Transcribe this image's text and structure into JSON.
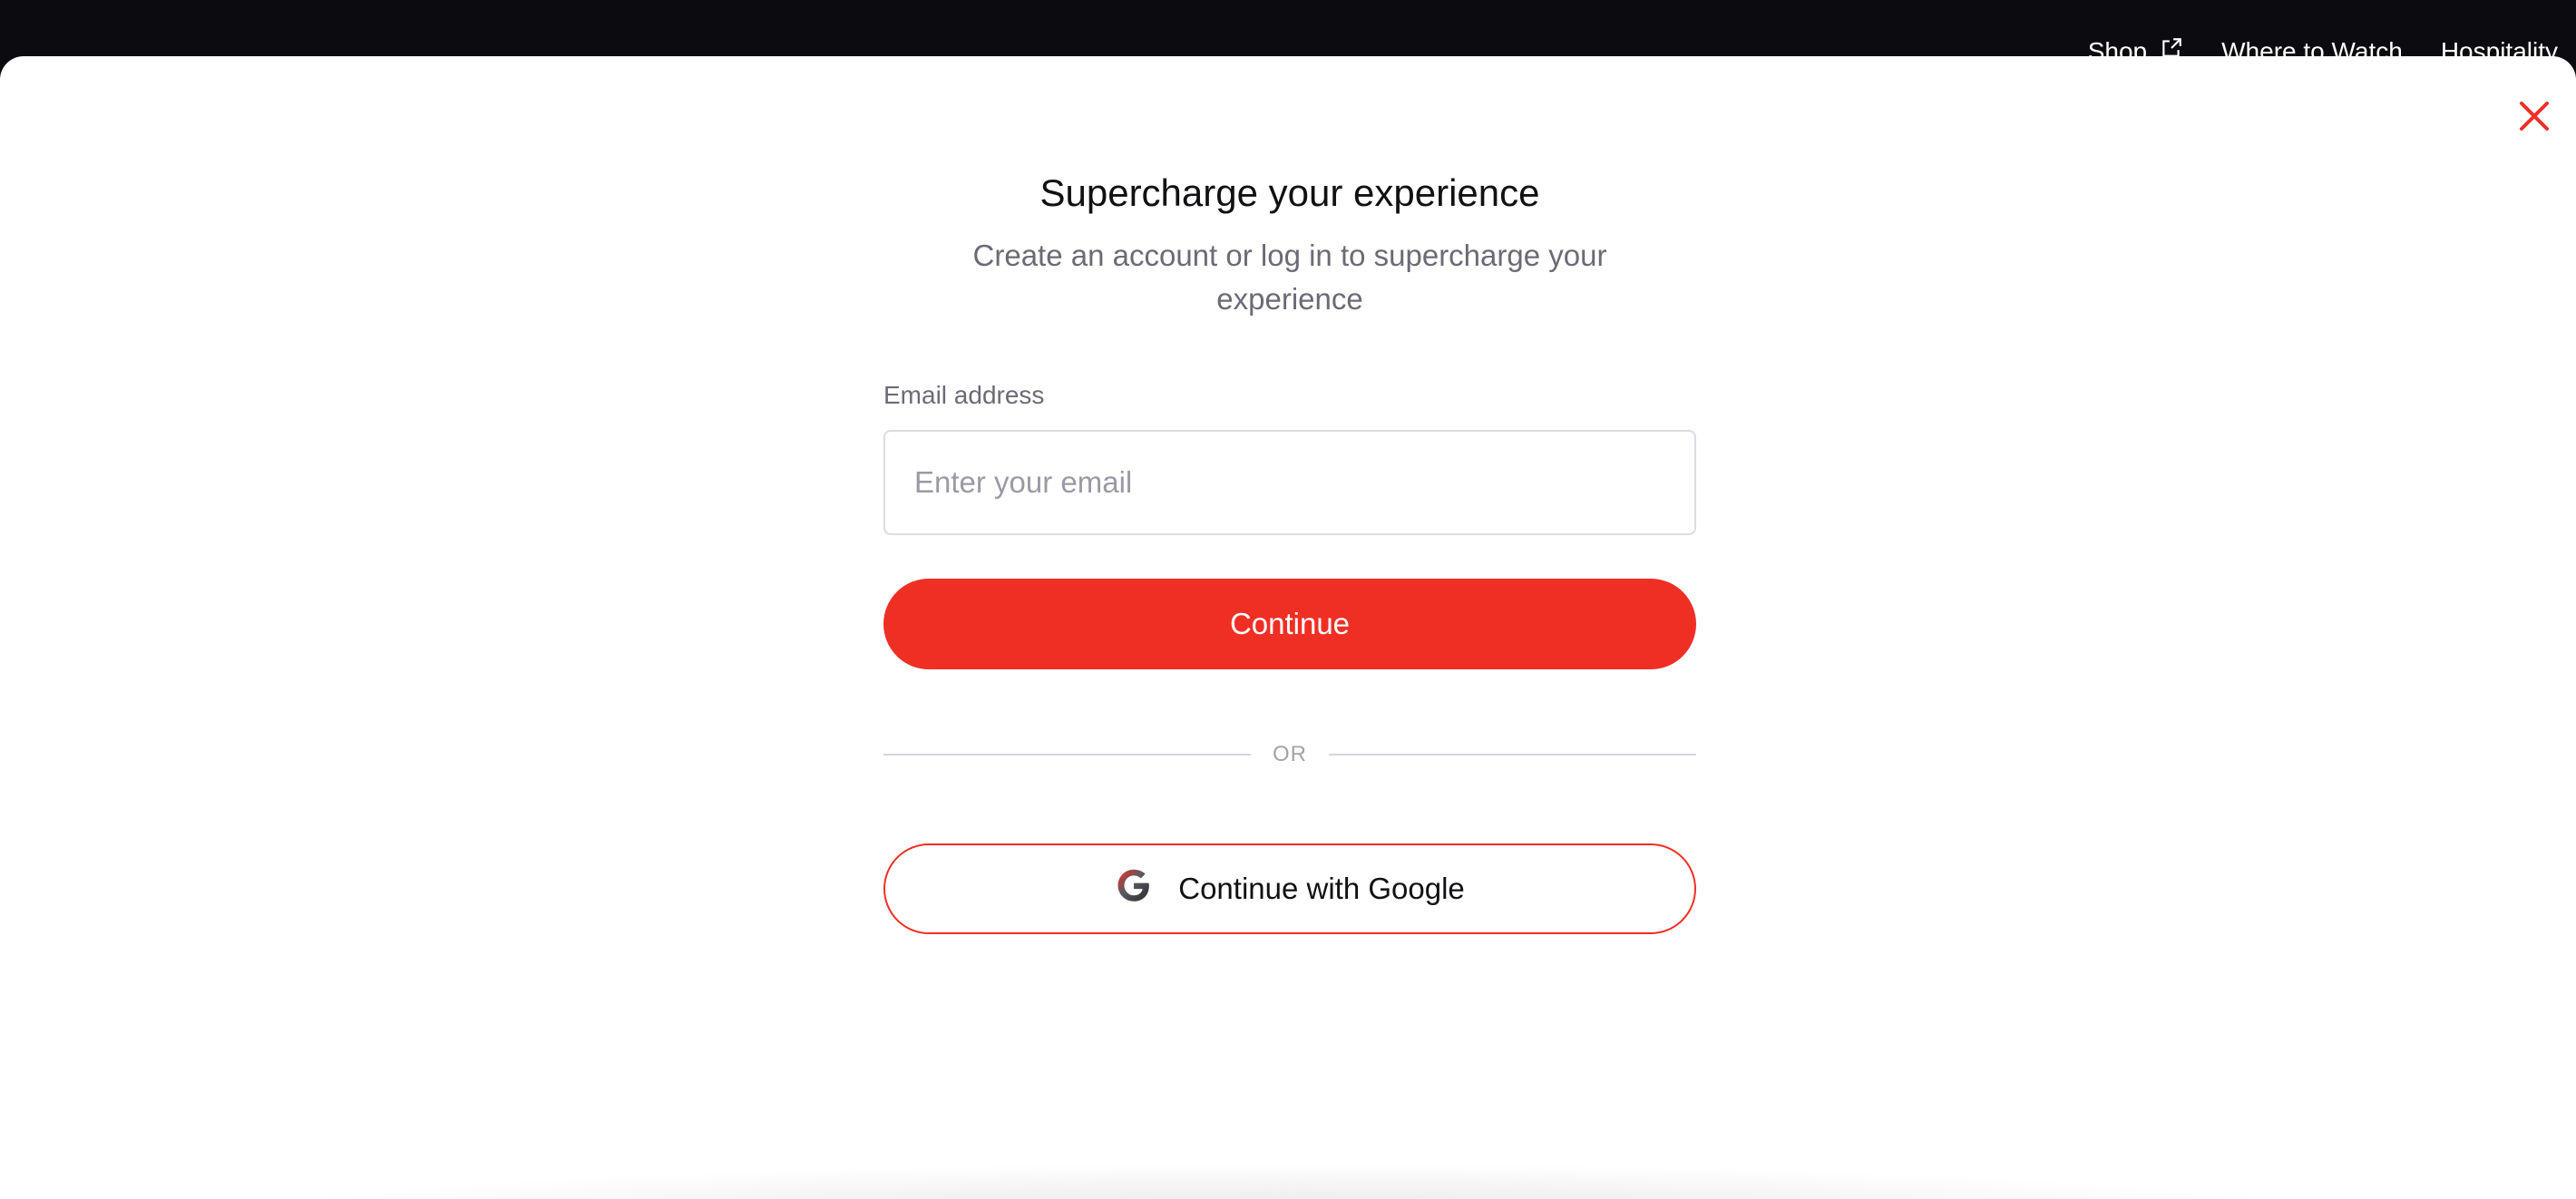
{
  "topnav": {
    "items": [
      {
        "label": "Shop",
        "icon": "external-link-icon"
      },
      {
        "label": "Where to Watch"
      },
      {
        "label": "Hospitality"
      }
    ]
  },
  "modal": {
    "close_icon": "close-icon",
    "title": "Supercharge your experience",
    "subtitle": "Create an account or log in to supercharge your experience",
    "email": {
      "label": "Email address",
      "placeholder": "Enter your email",
      "value": ""
    },
    "continue_label": "Continue",
    "divider_text": "OR",
    "google_label": "Continue with Google",
    "google_icon": "google-icon"
  },
  "colors": {
    "accent": "#f02f24",
    "topbar": "#0c0c10",
    "muted_text": "#6b6b76"
  }
}
